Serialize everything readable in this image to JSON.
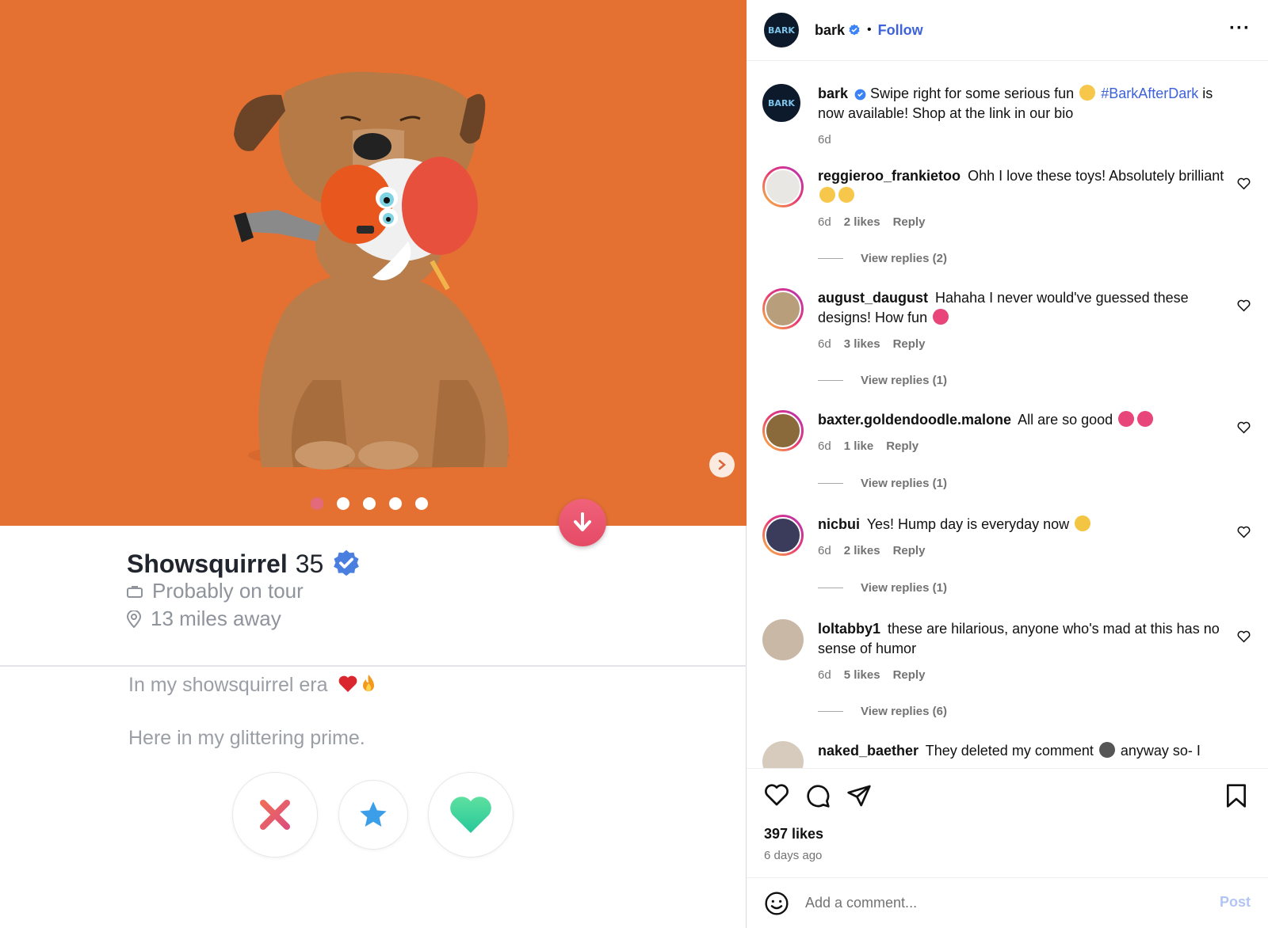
{
  "card": {
    "name": "Showsquirrel",
    "age": "35",
    "job": "Probably on tour",
    "distance": "13 miles away",
    "bio_line1": "In my showsquirrel era",
    "bio_line2": "Here in my glittering prime.",
    "photo_count": 5,
    "active_photo": 1
  },
  "header": {
    "account": "bark",
    "follow_label": "Follow",
    "separator": "•",
    "more_label": "···"
  },
  "caption": {
    "user": "bark",
    "text_before": "Swipe right for some serious fun",
    "hashtag": "#BarkAfterDark",
    "text_after": "is now available! Shop at the link in our bio",
    "time": "6d"
  },
  "comments": [
    {
      "user": "reggieroo_frankietoo",
      "text": "Ohh I love these toys! Absolutely brilliant",
      "time": "6d",
      "likes": "2 likes",
      "reply": "Reply",
      "view_replies": "View replies (2)"
    },
    {
      "user": "august_daugust",
      "text": "Hahaha I never would've guessed these designs! How fun",
      "time": "6d",
      "likes": "3 likes",
      "reply": "Reply",
      "view_replies": "View replies (1)"
    },
    {
      "user": "baxter.goldendoodle.malone",
      "text": "All are so good",
      "time": "6d",
      "likes": "1 like",
      "reply": "Reply",
      "view_replies": "View replies (1)"
    },
    {
      "user": "nicbui",
      "text": "Yes! Hump day is everyday now",
      "time": "6d",
      "likes": "2 likes",
      "reply": "Reply",
      "view_replies": "View replies (1)"
    },
    {
      "user": "loltabby1",
      "text": "these are hilarious, anyone who's mad at this has no sense of humor",
      "time": "6d",
      "likes": "5 likes",
      "reply": "Reply",
      "view_replies": "View replies (6)"
    },
    {
      "user": "naked_baether",
      "text": "They deleted my comment",
      "text_after": "anyway so- I"
    }
  ],
  "footer": {
    "likes": "397 likes",
    "time_ago": "6 days ago",
    "comment_placeholder": "Add a comment...",
    "post_label": "Post"
  },
  "colors": {
    "photo_bg": "#e47132",
    "link_blue": "#3d62d9",
    "nope_red": "#e55451",
    "superlike_blue": "#3a9ee8",
    "like_green": "#3fd59b"
  }
}
